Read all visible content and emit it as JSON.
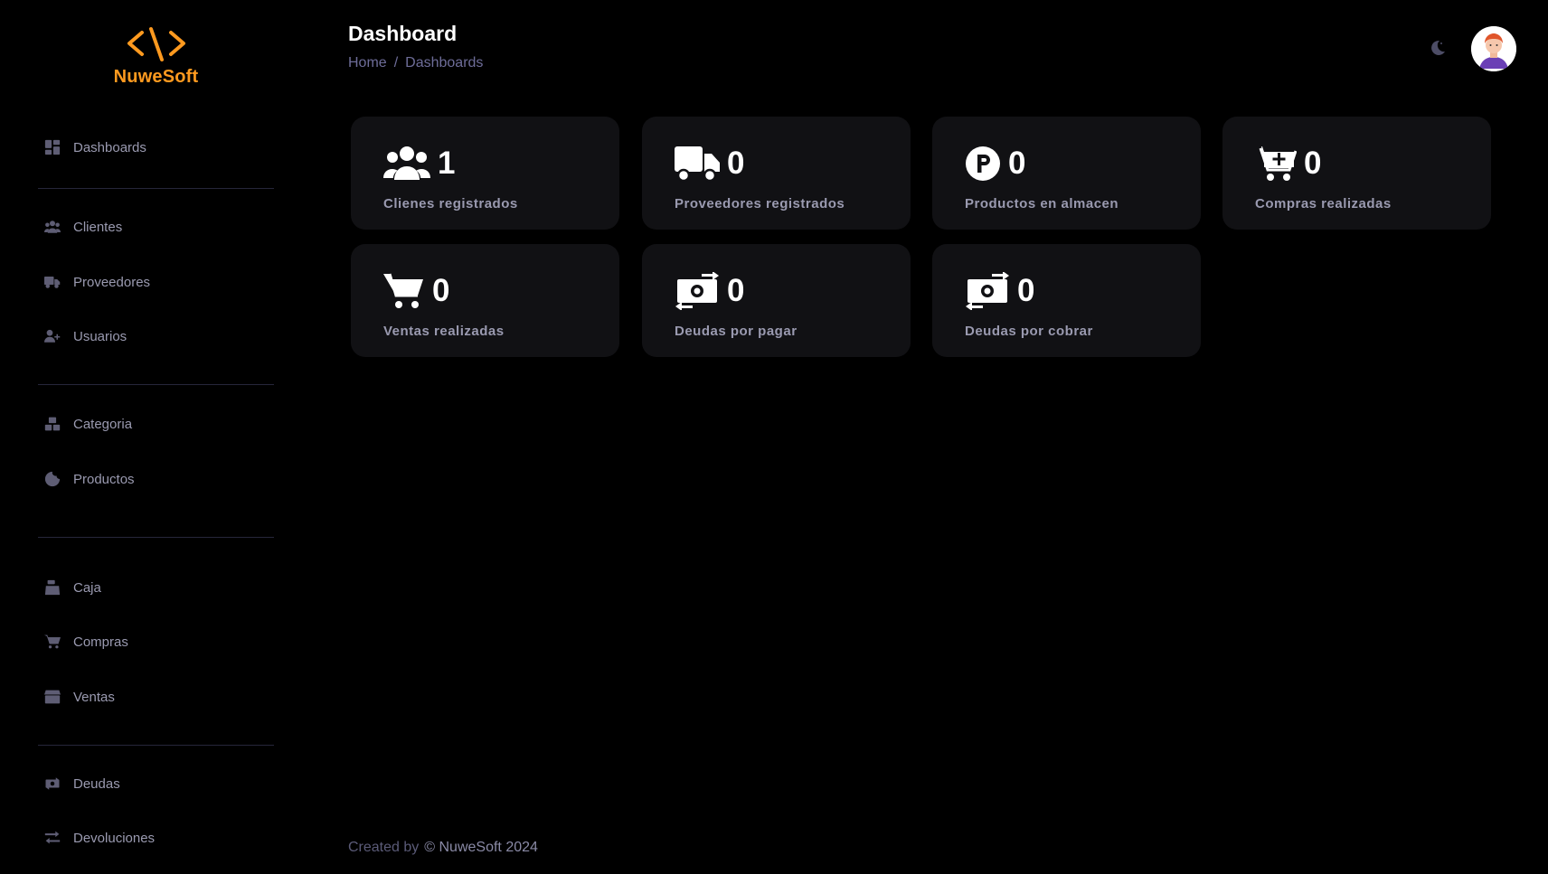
{
  "brand": {
    "name": "NuweSoft",
    "accent_color": "#ff9a1f",
    "logo_icon": "code-brackets-icon"
  },
  "sidebar": {
    "items": [
      {
        "label": "Dashboards",
        "icon": "dashboard-grid-icon"
      },
      {
        "label": "Clientes",
        "icon": "users-icon"
      },
      {
        "label": "Proveedores",
        "icon": "truck-icon"
      },
      {
        "label": "Usuarios",
        "icon": "user-plus-icon"
      },
      {
        "label": "Categoria",
        "icon": "boxes-icon"
      },
      {
        "label": "Productos",
        "icon": "cookie-icon"
      },
      {
        "label": "Caja",
        "icon": "cash-register-icon"
      },
      {
        "label": "Compras",
        "icon": "cart-icon"
      },
      {
        "label": "Ventas",
        "icon": "store-icon"
      },
      {
        "label": "Deudas",
        "icon": "money-bill-transfer-icon"
      },
      {
        "label": "Devoluciones",
        "icon": "arrows-exchange-icon"
      }
    ]
  },
  "header": {
    "title": "Dashboard",
    "breadcrumb": [
      "Home",
      "Dashboards"
    ],
    "breadcrumb_separator": "/",
    "theme_toggle_icon": "moon-icon",
    "avatar_icon": "user-avatar-icon"
  },
  "cards": [
    {
      "value": "1",
      "label": "Clienes registrados",
      "icon": "users-icon"
    },
    {
      "value": "0",
      "label": "Proveedores registrados",
      "icon": "truck-icon"
    },
    {
      "value": "0",
      "label": "Productos en almacen",
      "icon": "parking-p-icon"
    },
    {
      "value": "0",
      "label": "Compras realizadas",
      "icon": "cart-plus-icon"
    },
    {
      "value": "0",
      "label": "Ventas realizadas",
      "icon": "cart-icon"
    },
    {
      "value": "0",
      "label": "Deudas por pagar",
      "icon": "money-bill-transfer-icon"
    },
    {
      "value": "0",
      "label": "Deudas por cobrar",
      "icon": "money-bill-transfer-icon"
    }
  ],
  "footer": {
    "created_by": "Created by",
    "copyright": "© NuweSoft 2024"
  }
}
